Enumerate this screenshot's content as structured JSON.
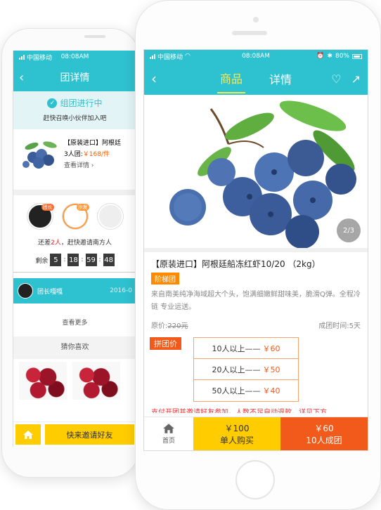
{
  "back": {
    "status": {
      "carrier": "中国移动",
      "time": "08:08AM"
    },
    "title": "团详情",
    "banner": {
      "state": "组团进行中",
      "sub": "赶快召唤小伙伴加入吧"
    },
    "product": {
      "name": "【原装进口】阿根廷",
      "group": "3人团:",
      "price": "￥168/件",
      "detail": "查看详情"
    },
    "avatars": [
      {
        "tag": "团长"
      },
      {
        "tag": "沙发"
      }
    ],
    "need": {
      "pre": "还差",
      "num": "2人",
      "post": "，赶快邀请南方人"
    },
    "timer": {
      "label": "剩余",
      "digits": [
        "5",
        "18",
        "59",
        "48"
      ]
    },
    "leader": {
      "name": "团长嘎嘎",
      "date": "2016-0"
    },
    "more": "查看更多",
    "guess": "猜你喜欢",
    "invite": "快来邀请好友"
  },
  "front": {
    "status": {
      "carrier": "中国移动",
      "time": "08:08AM",
      "battery": "80%"
    },
    "tabs": [
      "商品",
      "详情"
    ],
    "pager": "2/3",
    "title": "【原装进口】阿根廷船冻红虾10/20 （2kg）",
    "ladder_tag": "阶梯团",
    "desc": "来自南美纯净海域超大个头，饱满细嫩鲜甜味美，脆滑Q弹。全程冷链 专业运送。",
    "orig_label": "原价:",
    "orig_price": "220元",
    "group_time": "成团时间:5天",
    "tier_label": "拼团价",
    "tiers": [
      {
        "cond": "10人以上——",
        "price": "￥60"
      },
      {
        "cond": "20人以上——",
        "price": "￥50"
      },
      {
        "cond": "50人以上——",
        "price": "￥40"
      }
    ],
    "notice": "支付开团并邀请好友参加，人数不足自动退款，详见下方",
    "bottom": {
      "home": "首页",
      "single_price": "￥100",
      "single_label": "单人购买",
      "group_price": "￥60",
      "group_label": "10人成团"
    }
  },
  "colors": {
    "teal": "#2ec1cf",
    "yellow": "#ffcc00",
    "orange": "#f25a1b",
    "price_red": "#ff5a00"
  }
}
